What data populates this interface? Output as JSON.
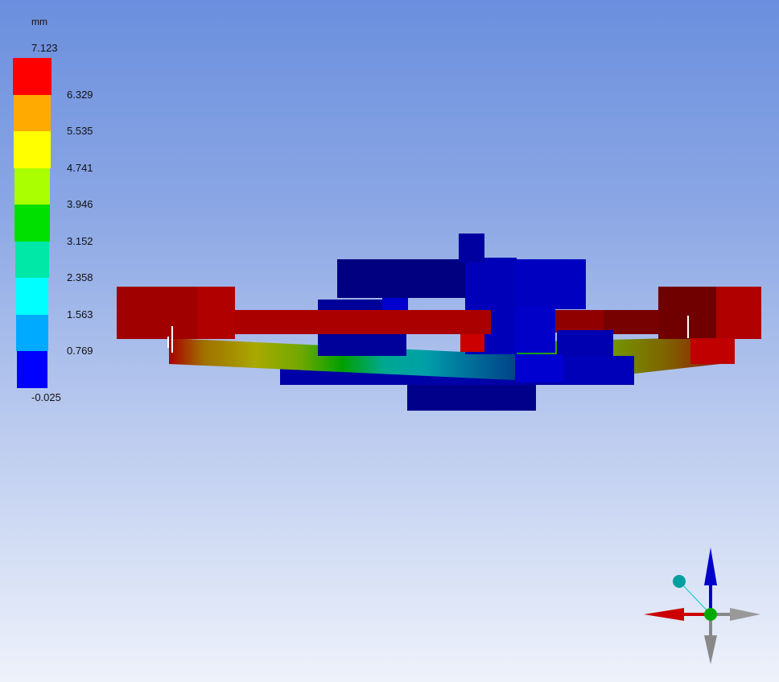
{
  "legend": {
    "unit": "mm",
    "max_label": "7.123",
    "min_label": "-0.025",
    "labels": [
      "6.329",
      "5.535",
      "4.741",
      "3.946",
      "3.152",
      "2.358",
      "1.563",
      "0.769"
    ],
    "colors": [
      "#ff0000",
      "#ffaa00",
      "#ffff00",
      "#aaff00",
      "#00e000",
      "#00e8a8",
      "#00ffff",
      "#00aaff",
      "#0000ff"
    ]
  },
  "colors": {
    "model_dark_blue": "#00007a",
    "model_blue": "#0000c8",
    "model_red": "#b00000",
    "model_dark_red": "#7a0000",
    "triad_x": "#cc0000",
    "triad_y": "#0000cc",
    "triad_z": "#808080",
    "triad_center": "#00aa00",
    "triad_iso": "#00a0a0"
  }
}
